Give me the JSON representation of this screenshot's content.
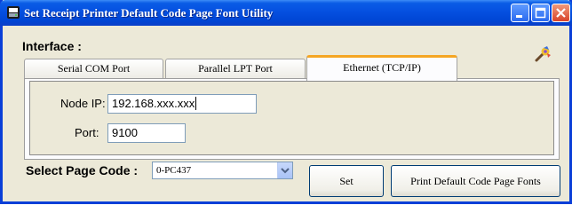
{
  "window": {
    "title": "Set Receipt Printer Default Code Page Font Utility"
  },
  "interface": {
    "label": "Interface :",
    "tabs": [
      {
        "label": "Serial COM Port",
        "active": false
      },
      {
        "label": "Parallel LPT Port",
        "active": false
      },
      {
        "label": "Ethernet (TCP/IP)",
        "active": true
      }
    ]
  },
  "ethernet": {
    "node_ip_label": "Node IP:",
    "node_ip_value": "192.168.xxx.xxx",
    "port_label": "Port:",
    "port_value": "9100"
  },
  "page_code": {
    "label": "Select Page Code :",
    "selected": "0-PC437"
  },
  "buttons": {
    "set": "Set",
    "print": "Print Default Code Page Fonts"
  },
  "colors": {
    "titlebar": "#0550e0",
    "active_tab_accent": "#f5a623",
    "close_button": "#d9442a",
    "window_face": "#ece9d8"
  },
  "icons": {
    "app": "printer-app-icon",
    "tool": "multicolor-tool-icon"
  }
}
